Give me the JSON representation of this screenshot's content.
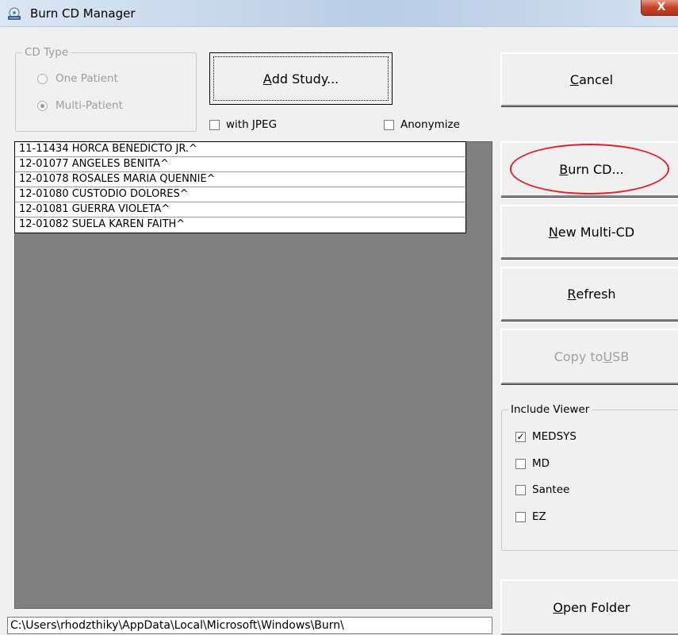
{
  "window": {
    "title": "Burn CD Manager",
    "close_label": "X"
  },
  "cd_type": {
    "legend": "CD Type",
    "options": [
      {
        "label": "One Patient",
        "selected": false
      },
      {
        "label": "Multi-Patient",
        "selected": true
      }
    ]
  },
  "actions": {
    "add_study_prefix": "A",
    "add_study_rest": "dd Study...",
    "with_jpeg_label": "with JPEG",
    "with_jpeg_checked": false,
    "anonymize_label": "Anonymize",
    "anonymize_checked": false
  },
  "buttons": {
    "cancel_u": "C",
    "cancel_rest": "ancel",
    "burn_u": "B",
    "burn_rest": "urn CD...",
    "new_multi_u": "N",
    "new_multi_rest": "ew Multi-CD",
    "refresh_u": "R",
    "refresh_rest": "efresh",
    "copy_usb_pre": "Copy to ",
    "copy_usb_u": "U",
    "copy_usb_rest": "SB",
    "open_folder_u": "O",
    "open_folder_rest": "pen Folder"
  },
  "patients": [
    "11-11434 HORCA BENEDICTO JR.^",
    "12-01077 ANGELES BENITA^",
    "12-01078 ROSALES MARIA QUENNIE^",
    "12-01080 CUSTODIO DOLORES^",
    "12-01081 GUERRA VIOLETA^",
    "12-01082 SUELA KAREN FAITH^"
  ],
  "include_viewer": {
    "legend": "Include Viewer",
    "options": [
      {
        "label": "MEDSYS",
        "checked": true
      },
      {
        "label": "MD",
        "checked": false
      },
      {
        "label": "Santee",
        "checked": false
      },
      {
        "label": "EZ",
        "checked": false
      }
    ]
  },
  "path": "C:\\Users\\rhodzthiky\\AppData\\Local\\Microsoft\\Windows\\Burn\\",
  "colors": {
    "highlight": "#e0202a",
    "list_background": "#808080"
  }
}
